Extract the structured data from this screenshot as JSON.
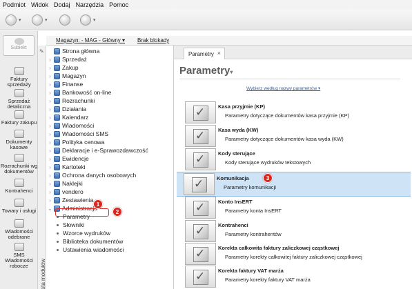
{
  "menu": [
    "Podmiot",
    "Widok",
    "Dodaj",
    "Narzędzia",
    "Pomoc"
  ],
  "toolbar": {
    "icons": [
      "new-icon",
      "edit-icon",
      "currency-icon",
      "help-icon"
    ]
  },
  "leftnav": {
    "logo": "Subiekt",
    "items": [
      {
        "label": "Faktury sprzedaży",
        "icon": "invoice-icon"
      },
      {
        "label": "Sprzedaż detaliczna",
        "icon": "receipt-icon"
      },
      {
        "label": "Faktury zakupu",
        "icon": "purchase-icon"
      },
      {
        "label": "Dokumenty kasowe",
        "icon": "cash-icon"
      },
      {
        "label": "Rozrachunki wg dokumentów",
        "icon": "settlement-icon"
      },
      {
        "label": "Kontrahenci",
        "icon": "contacts-icon"
      },
      {
        "label": "Towary i usługi",
        "icon": "goods-icon"
      },
      {
        "label": "Wiadomości odebrane",
        "icon": "inbox-icon"
      },
      {
        "label": "SMS Wiadomości robocze",
        "icon": "sms-icon"
      }
    ]
  },
  "magbar": {
    "magazyn": "Magazyn: - MAG - Główny ▾",
    "blokady": "Brak blokady"
  },
  "vtab": {
    "label": "Lista modułów"
  },
  "tree": {
    "items": [
      "Strona główna",
      "Sprzedaż",
      "Zakup",
      "Magazyn",
      "Finanse",
      "Bankowość on-line",
      "Rozrachunki",
      "Działania",
      "Kalendarz",
      "Wiadomości",
      "Wiadomości SMS",
      "Polityka cenowa",
      "Deklaracje i e-Sprawozdawczość",
      "Ewidencje",
      "Kartoteki",
      "Ochrona danych osobowych",
      "Naklejki",
      "vendero",
      "Zestawienia",
      "Administracja"
    ],
    "subitems": [
      "Parametry",
      "Słowniki",
      "Wzorce wydruków",
      "Biblioteka dokumentów",
      "Ustawienia wiadomości"
    ]
  },
  "badges": [
    "1",
    "2",
    "3"
  ],
  "pane": {
    "tab": "Parametry",
    "title": "Parametry",
    "subselect": "Wybierz według nazwy parametrów ▾",
    "cards": [
      {
        "title": "Kasa przyjmie (KP)",
        "desc": "Parametry dotyczące dokumentów kasa przyjmie (KP)"
      },
      {
        "title": "Kasa wyda (KW)",
        "desc": "Parametry dotyczące dokumentów kasa wyda (KW)"
      },
      {
        "title": "Kody sterujące",
        "desc": "Kody sterujące wydruków tekstowych"
      },
      {
        "title": "Komunikacja",
        "desc": "Parametry komunikacji"
      },
      {
        "title": "Konto InsERT",
        "desc": "Parametry konta InsERT"
      },
      {
        "title": "Kontrahenci",
        "desc": "Parametry kontrahentów"
      },
      {
        "title": "Korekta całkowita faktury zaliczkowej cząstkowej",
        "desc": "Parametry korekty całkowitej faktury zaliczkowej cząstkowej"
      },
      {
        "title": "Korekta faktury VAT marża",
        "desc": "Parametry korekty faktury VAT marża"
      }
    ]
  }
}
